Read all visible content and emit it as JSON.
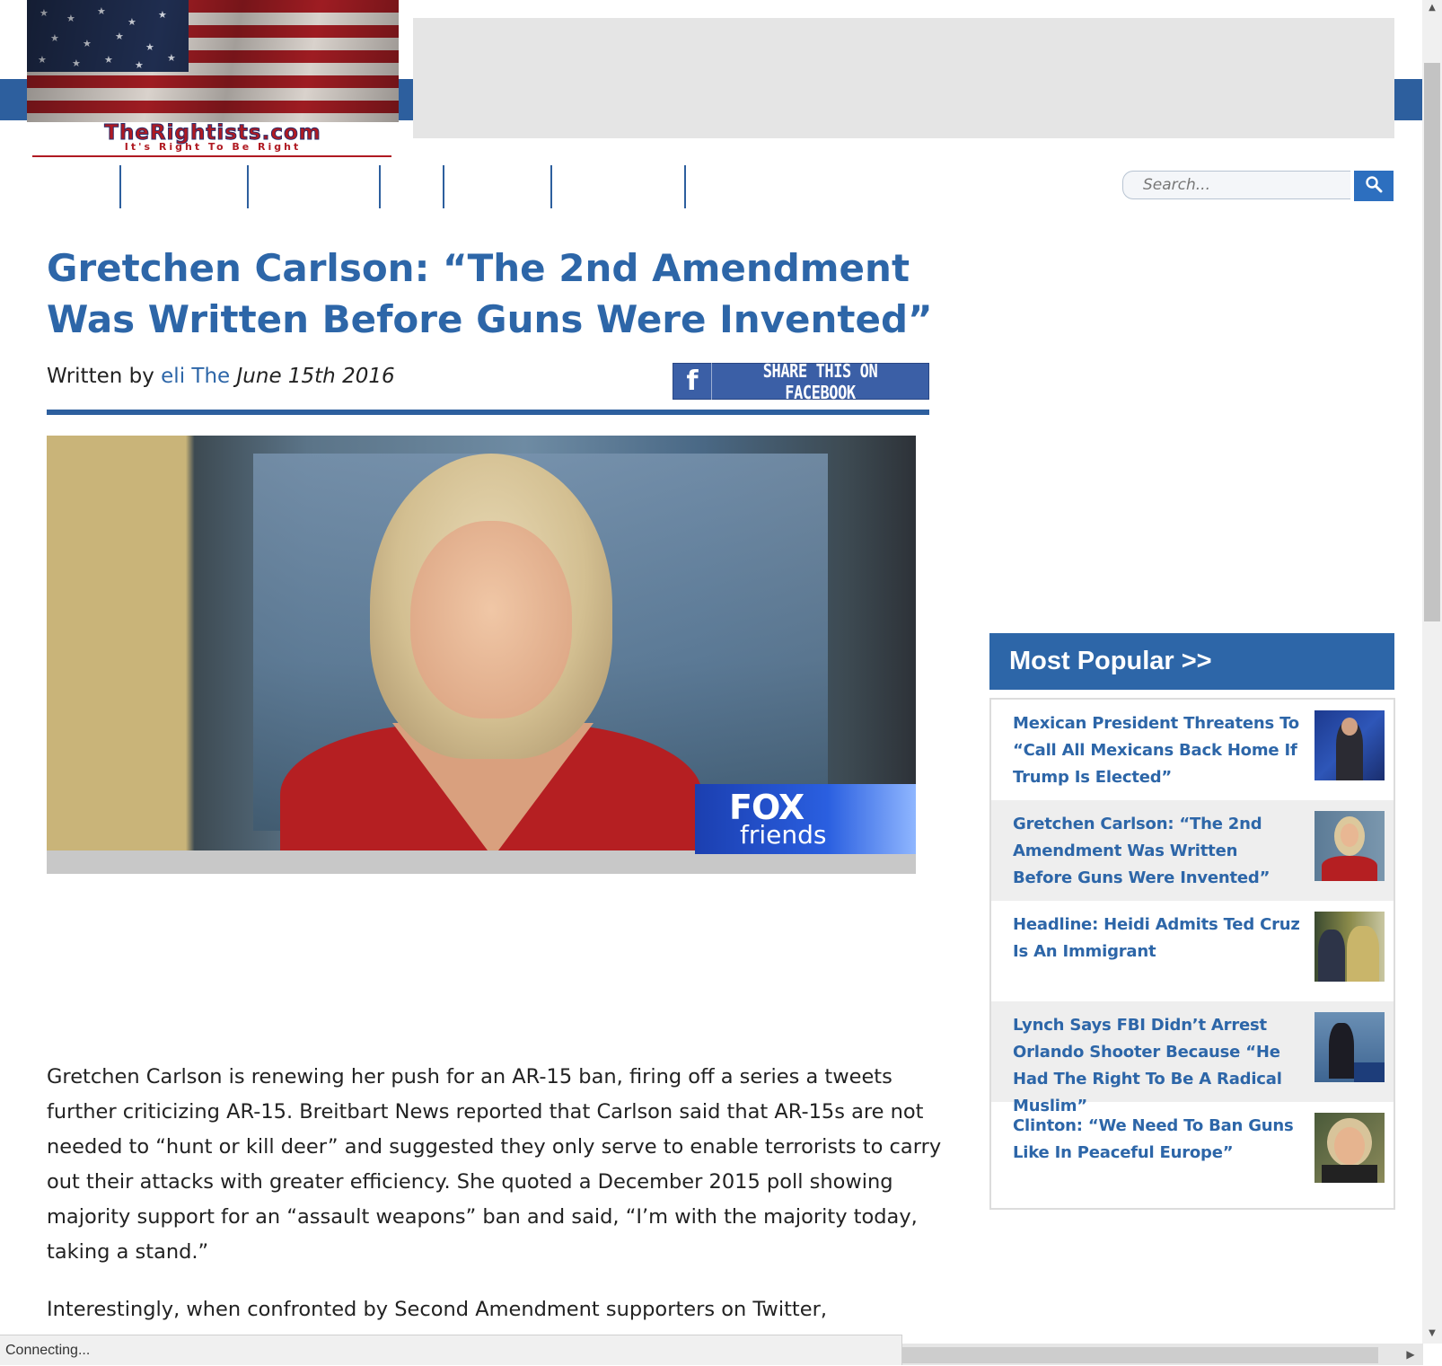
{
  "site": {
    "logo_name": "TheRightists.com",
    "logo_tagline": "It's Right To Be Right"
  },
  "search": {
    "placeholder": "Search..."
  },
  "article": {
    "title": "Gretchen Carlson: “The 2nd Amendment Was Written Before Guns Were Invented”",
    "byline_prefix": "Written by",
    "author": "eli The",
    "date": "June 15th 2016",
    "share_label": "SHARE THIS ON FACEBOOK",
    "share_icon": "f",
    "hero_overlay_brand": "FOX",
    "hero_overlay_sub": "friends",
    "paragraphs": [
      "Gretchen Carlson is renewing her push for an AR-15 ban, firing off a series a tweets further criticizing AR-15. Breitbart News reported that Carlson said that AR-15s are not needed to “hunt or kill deer” and suggested they only serve to enable terrorists to carry out their attacks with greater efficiency. She quoted a December 2015 poll showing majority support for an “assault weapons” ban and said, “I’m with the majority today, taking a stand.”",
      "Interestingly, when confronted by Second Amendment supporters on Twitter,"
    ]
  },
  "sidebar": {
    "header": "Most Popular >>",
    "items": [
      {
        "title": "Mexican President Threatens To “Call All Mexicans Back Home If Trump Is Elected”"
      },
      {
        "title": "Gretchen Carlson: “The 2nd Amendment Was Written Before Guns Were Invented”"
      },
      {
        "title": "Headline: Heidi Admits Ted Cruz Is An Immigrant"
      },
      {
        "title": "Lynch Says FBI Didn’t Arrest Orlando Shooter Because “He Had The Right To Be A Radical Muslim”"
      },
      {
        "title": "Clinton: “We Need To Ban Guns Like In Peaceful Europe”"
      }
    ]
  },
  "status_bar": {
    "text": "Connecting..."
  },
  "colors": {
    "brand_blue": "#2d66a8",
    "nav_blue": "#2d5f9e",
    "facebook_blue": "#3b5fa6"
  }
}
